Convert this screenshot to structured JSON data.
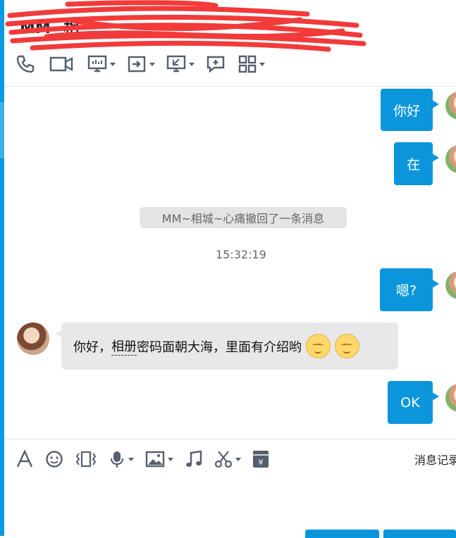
{
  "header": {
    "contact_name": "MM~相"
  },
  "toolbar": {
    "icons": [
      "phone-icon",
      "video-icon",
      "screen-share-icon",
      "file-transfer-icon",
      "remote-desktop-icon",
      "message-plus-icon",
      "apps-grid-icon"
    ]
  },
  "messages": {
    "out1": "你好",
    "out2": "在",
    "system": "MM~相城~心痛撤回了一条消息",
    "time": "15:32:19",
    "out3": "嗯?",
    "in_prefix": "你好，",
    "in_link": "相册",
    "in_rest": "密码面朝大海，里面有介绍哟",
    "out4": "OK"
  },
  "input_toolbar": {
    "history": "消息记录"
  },
  "colors": {
    "accent": "#0b96dc",
    "bubble_in": "#e8e8e8",
    "system_bg": "#e4e4e4",
    "icon": "#555e6e"
  }
}
